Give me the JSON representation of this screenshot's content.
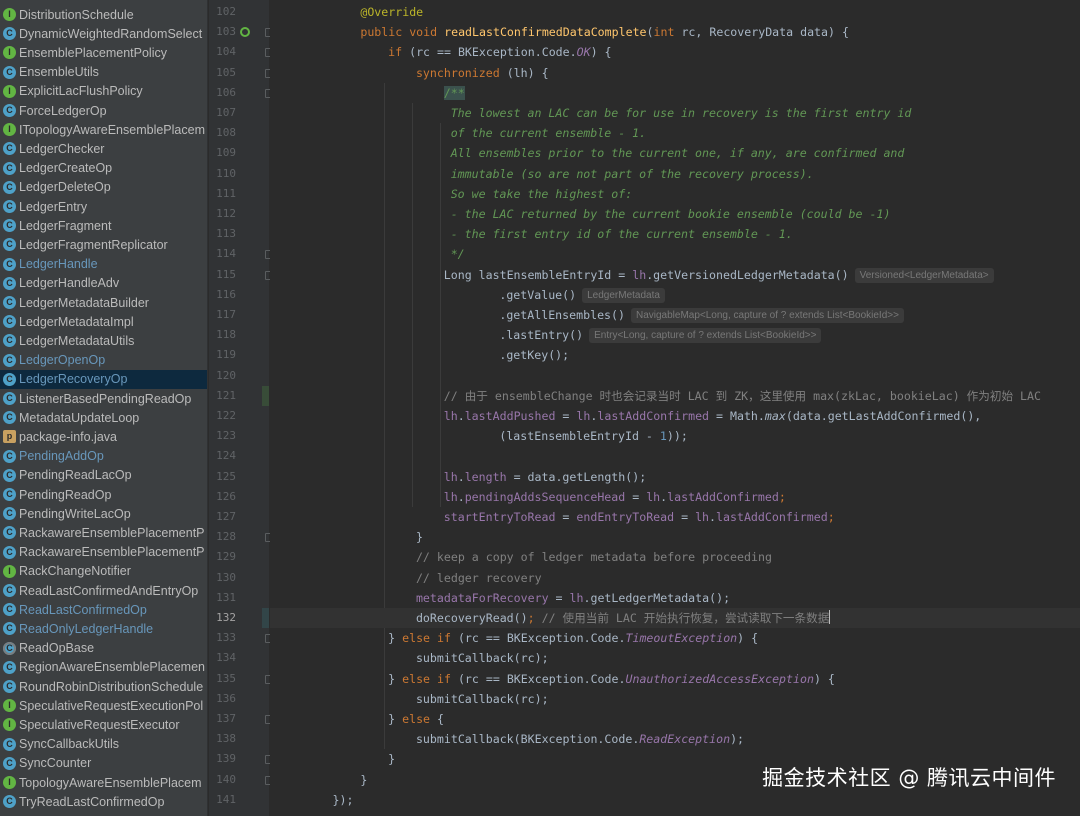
{
  "project_tree": {
    "items": [
      {
        "label": "DistributionSchedule",
        "icon": "interface-icon"
      },
      {
        "label": "DynamicWeightedRandomSelect",
        "icon": "class-icon"
      },
      {
        "label": "EnsemblePlacementPolicy",
        "icon": "interface-icon"
      },
      {
        "label": "EnsembleUtils",
        "icon": "class-icon"
      },
      {
        "label": "ExplicitLacFlushPolicy",
        "icon": "interface-icon"
      },
      {
        "label": "ForceLedgerOp",
        "icon": "class-icon"
      },
      {
        "label": "ITopologyAwareEnsemblePlacem",
        "icon": "interface-icon"
      },
      {
        "label": "LedgerChecker",
        "icon": "class-icon"
      },
      {
        "label": "LedgerCreateOp",
        "icon": "class-icon"
      },
      {
        "label": "LedgerDeleteOp",
        "icon": "class-icon"
      },
      {
        "label": "LedgerEntry",
        "icon": "class-icon"
      },
      {
        "label": "LedgerFragment",
        "icon": "class-icon"
      },
      {
        "label": "LedgerFragmentReplicator",
        "icon": "class-icon"
      },
      {
        "label": "LedgerHandle",
        "icon": "class-icon",
        "modified": true
      },
      {
        "label": "LedgerHandleAdv",
        "icon": "class-icon"
      },
      {
        "label": "LedgerMetadataBuilder",
        "icon": "class-icon"
      },
      {
        "label": "LedgerMetadataImpl",
        "icon": "class-icon"
      },
      {
        "label": "LedgerMetadataUtils",
        "icon": "class-icon"
      },
      {
        "label": "LedgerOpenOp",
        "icon": "class-icon",
        "modified": true
      },
      {
        "label": "LedgerRecoveryOp",
        "icon": "class-icon",
        "modified": true,
        "selected": true
      },
      {
        "label": "ListenerBasedPendingReadOp",
        "icon": "class-icon"
      },
      {
        "label": "MetadataUpdateLoop",
        "icon": "class-icon"
      },
      {
        "label": "package-info.java",
        "icon": "package-icon"
      },
      {
        "label": "PendingAddOp",
        "icon": "class-icon",
        "modified": true
      },
      {
        "label": "PendingReadLacOp",
        "icon": "class-icon"
      },
      {
        "label": "PendingReadOp",
        "icon": "class-icon"
      },
      {
        "label": "PendingWriteLacOp",
        "icon": "class-icon"
      },
      {
        "label": "RackawareEnsemblePlacementP",
        "icon": "class-icon"
      },
      {
        "label": "RackawareEnsemblePlacementP",
        "icon": "class-icon"
      },
      {
        "label": "RackChangeNotifier",
        "icon": "interface-icon"
      },
      {
        "label": "ReadLastConfirmedAndEntryOp",
        "icon": "class-icon"
      },
      {
        "label": "ReadLastConfirmedOp",
        "icon": "class-icon",
        "modified": true
      },
      {
        "label": "ReadOnlyLedgerHandle",
        "icon": "class-icon",
        "modified": true
      },
      {
        "label": "ReadOpBase",
        "icon": "abstract-icon"
      },
      {
        "label": "RegionAwareEnsemblePlacemen",
        "icon": "class-icon"
      },
      {
        "label": "RoundRobinDistributionSchedule",
        "icon": "class-icon"
      },
      {
        "label": "SpeculativeRequestExecutionPol",
        "icon": "interface-icon"
      },
      {
        "label": "SpeculativeRequestExecutor",
        "icon": "interface-icon"
      },
      {
        "label": "SyncCallbackUtils",
        "icon": "class-icon"
      },
      {
        "label": "SyncCounter",
        "icon": "class-icon"
      },
      {
        "label": "TopologyAwareEnsemblePlacem",
        "icon": "interface-icon"
      },
      {
        "label": "TryReadLastConfirmedOp",
        "icon": "class-icon"
      }
    ]
  },
  "editor": {
    "current_line": "132",
    "lines": [
      {
        "num": "102",
        "indent": 13,
        "tokens": [
          {
            "t": "@Override",
            "c": "annotation"
          }
        ]
      },
      {
        "num": "103",
        "indent": 13,
        "tokens": [
          {
            "t": "public void ",
            "c": "keyword"
          },
          {
            "t": "readLastConfirmedDataComplete",
            "c": "method"
          },
          {
            "t": "(",
            "c": "plain"
          },
          {
            "t": "int ",
            "c": "keyword"
          },
          {
            "t": "rc, RecoveryData data) {",
            "c": "plain"
          }
        ]
      },
      {
        "num": "104",
        "indent": 17,
        "tokens": [
          {
            "t": "if ",
            "c": "keyword"
          },
          {
            "t": "(rc == BKException.Code.",
            "c": "plain"
          },
          {
            "t": "OK",
            "c": "italic-field"
          },
          {
            "t": ") {",
            "c": "plain"
          }
        ]
      },
      {
        "num": "105",
        "indent": 21,
        "tokens": [
          {
            "t": "synchronized ",
            "c": "keyword"
          },
          {
            "t": "(lh) {",
            "c": "plain"
          }
        ]
      },
      {
        "num": "106",
        "indent": 25,
        "tokens": [
          {
            "t": "/**",
            "c": "doc-start"
          }
        ]
      },
      {
        "num": "107",
        "indent": 26,
        "tokens": [
          {
            "t": "The lowest an LAC can be for use in recovery is the first entry id",
            "c": "doc"
          }
        ]
      },
      {
        "num": "108",
        "indent": 26,
        "tokens": [
          {
            "t": "of the current ensemble - 1.",
            "c": "doc"
          }
        ]
      },
      {
        "num": "109",
        "indent": 26,
        "tokens": [
          {
            "t": "All ensembles prior to the current one, if any, are confirmed and",
            "c": "doc"
          }
        ]
      },
      {
        "num": "110",
        "indent": 26,
        "tokens": [
          {
            "t": "immutable (so are not part of the recovery process).",
            "c": "doc"
          }
        ]
      },
      {
        "num": "111",
        "indent": 26,
        "tokens": [
          {
            "t": "So we take the highest of:",
            "c": "doc"
          }
        ]
      },
      {
        "num": "112",
        "indent": 26,
        "tokens": [
          {
            "t": "- the LAC returned by the current bookie ensemble (could be -1)",
            "c": "doc"
          }
        ]
      },
      {
        "num": "113",
        "indent": 26,
        "tokens": [
          {
            "t": "- the first entry id of the current ensemble - 1.",
            "c": "doc"
          }
        ]
      },
      {
        "num": "114",
        "indent": 26,
        "tokens": [
          {
            "t": "*/",
            "c": "doc"
          }
        ]
      },
      {
        "num": "115",
        "indent": 25,
        "tokens": [
          {
            "t": "Long lastEnsembleEntryId = ",
            "c": "plain"
          },
          {
            "t": "lh",
            "c": "field"
          },
          {
            "t": ".getVersionedLedgerMetadata()",
            "c": "plain"
          },
          {
            "t": "Versioned<LedgerMetadata>",
            "c": "hint"
          }
        ]
      },
      {
        "num": "116",
        "indent": 33,
        "tokens": [
          {
            "t": ".getValue()",
            "c": "plain"
          },
          {
            "t": "LedgerMetadata",
            "c": "hint"
          }
        ]
      },
      {
        "num": "117",
        "indent": 33,
        "tokens": [
          {
            "t": ".getAllEnsembles()",
            "c": "plain"
          },
          {
            "t": "NavigableMap<Long, capture of ? extends List<BookieId>>",
            "c": "hint"
          }
        ]
      },
      {
        "num": "118",
        "indent": 33,
        "tokens": [
          {
            "t": ".lastEntry()",
            "c": "plain"
          },
          {
            "t": "Entry<Long, capture of ? extends List<BookieId>>",
            "c": "hint"
          }
        ]
      },
      {
        "num": "119",
        "indent": 33,
        "tokens": [
          {
            "t": ".getKey();",
            "c": "plain"
          }
        ]
      },
      {
        "num": "120",
        "indent": 0,
        "tokens": []
      },
      {
        "num": "121",
        "indent": 25,
        "tokens": [
          {
            "t": "// 由于 ensembleChange 时也会记录当时 LAC 到 ZK，这里使用 max(zkLac, bookieLac) 作为初始 LAC",
            "c": "comment"
          }
        ]
      },
      {
        "num": "122",
        "indent": 25,
        "tokens": [
          {
            "t": "lh",
            "c": "field"
          },
          {
            "t": ".",
            "c": "plain"
          },
          {
            "t": "lastAddPushed",
            "c": "field"
          },
          {
            "t": " = ",
            "c": "plain"
          },
          {
            "t": "lh",
            "c": "field"
          },
          {
            "t": ".",
            "c": "plain"
          },
          {
            "t": "lastAddConfirmed",
            "c": "field"
          },
          {
            "t": " = Math.",
            "c": "plain"
          },
          {
            "t": "max",
            "c": "static"
          },
          {
            "t": "(data.getLastAddConfirmed(),",
            "c": "plain"
          }
        ]
      },
      {
        "num": "123",
        "indent": 33,
        "tokens": [
          {
            "t": "(lastEnsembleEntryId - ",
            "c": "plain"
          },
          {
            "t": "1",
            "c": "number"
          },
          {
            "t": "));",
            "c": "plain"
          }
        ]
      },
      {
        "num": "124",
        "indent": 0,
        "tokens": []
      },
      {
        "num": "125",
        "indent": 25,
        "tokens": [
          {
            "t": "lh",
            "c": "field"
          },
          {
            "t": ".",
            "c": "plain"
          },
          {
            "t": "length",
            "c": "field"
          },
          {
            "t": " = data.getLength();",
            "c": "plain"
          }
        ]
      },
      {
        "num": "126",
        "indent": 25,
        "tokens": [
          {
            "t": "lh",
            "c": "field"
          },
          {
            "t": ".",
            "c": "plain"
          },
          {
            "t": "pendingAddsSequenceHead",
            "c": "field"
          },
          {
            "t": " = ",
            "c": "plain"
          },
          {
            "t": "lh",
            "c": "field"
          },
          {
            "t": ".",
            "c": "plain"
          },
          {
            "t": "lastAddConfirmed",
            "c": "field"
          },
          {
            "t": ";",
            "c": "keyword"
          }
        ]
      },
      {
        "num": "127",
        "indent": 25,
        "tokens": [
          {
            "t": "startEntryToRead",
            "c": "field"
          },
          {
            "t": " = ",
            "c": "plain"
          },
          {
            "t": "endEntryToRead",
            "c": "field"
          },
          {
            "t": " = ",
            "c": "plain"
          },
          {
            "t": "lh",
            "c": "field"
          },
          {
            "t": ".",
            "c": "plain"
          },
          {
            "t": "lastAddConfirmed",
            "c": "field"
          },
          {
            "t": ";",
            "c": "keyword"
          }
        ]
      },
      {
        "num": "128",
        "indent": 21,
        "tokens": [
          {
            "t": "}",
            "c": "plain"
          }
        ]
      },
      {
        "num": "129",
        "indent": 21,
        "tokens": [
          {
            "t": "// keep a copy of ledger metadata before proceeding",
            "c": "comment"
          }
        ]
      },
      {
        "num": "130",
        "indent": 21,
        "tokens": [
          {
            "t": "// ledger recovery",
            "c": "comment"
          }
        ]
      },
      {
        "num": "131",
        "indent": 21,
        "tokens": [
          {
            "t": "metadataForRecovery",
            "c": "field"
          },
          {
            "t": " = ",
            "c": "plain"
          },
          {
            "t": "lh",
            "c": "field"
          },
          {
            "t": ".getLedgerMetadata();",
            "c": "plain"
          }
        ]
      },
      {
        "num": "132",
        "indent": 21,
        "caret": true,
        "tokens": [
          {
            "t": "doRecoveryRead()",
            "c": "plain"
          },
          {
            "t": "; ",
            "c": "keyword"
          },
          {
            "t": "// 使用当前 LAC 开始执行恢复，尝试读取下一条数据",
            "c": "comment"
          }
        ]
      },
      {
        "num": "133",
        "indent": 17,
        "tokens": [
          {
            "t": "} ",
            "c": "plain"
          },
          {
            "t": "else if ",
            "c": "keyword"
          },
          {
            "t": "(rc == BKException.Code.",
            "c": "plain"
          },
          {
            "t": "TimeoutException",
            "c": "italic-field"
          },
          {
            "t": ") {",
            "c": "plain"
          }
        ]
      },
      {
        "num": "134",
        "indent": 21,
        "tokens": [
          {
            "t": "submitCallback(rc);",
            "c": "plain"
          }
        ]
      },
      {
        "num": "135",
        "indent": 17,
        "tokens": [
          {
            "t": "} ",
            "c": "plain"
          },
          {
            "t": "else if ",
            "c": "keyword"
          },
          {
            "t": "(rc == BKException.Code.",
            "c": "plain"
          },
          {
            "t": "UnauthorizedAccessException",
            "c": "italic-field"
          },
          {
            "t": ") {",
            "c": "plain"
          }
        ]
      },
      {
        "num": "136",
        "indent": 21,
        "tokens": [
          {
            "t": "submitCallback(rc);",
            "c": "plain"
          }
        ]
      },
      {
        "num": "137",
        "indent": 17,
        "tokens": [
          {
            "t": "} ",
            "c": "plain"
          },
          {
            "t": "else ",
            "c": "keyword"
          },
          {
            "t": "{",
            "c": "plain"
          }
        ]
      },
      {
        "num": "138",
        "indent": 21,
        "tokens": [
          {
            "t": "submitCallback(BKException.Code.",
            "c": "plain"
          },
          {
            "t": "ReadException",
            "c": "italic-field"
          },
          {
            "t": ");",
            "c": "plain"
          }
        ]
      },
      {
        "num": "139",
        "indent": 17,
        "tokens": [
          {
            "t": "}",
            "c": "plain"
          }
        ]
      },
      {
        "num": "140",
        "indent": 13,
        "tokens": [
          {
            "t": "}",
            "c": "plain"
          }
        ]
      },
      {
        "num": "141",
        "indent": 9,
        "tokens": [
          {
            "t": "});",
            "c": "plain"
          }
        ]
      }
    ]
  },
  "watermark": {
    "text": "掘金技术社区 @ 腾讯云中间件"
  }
}
